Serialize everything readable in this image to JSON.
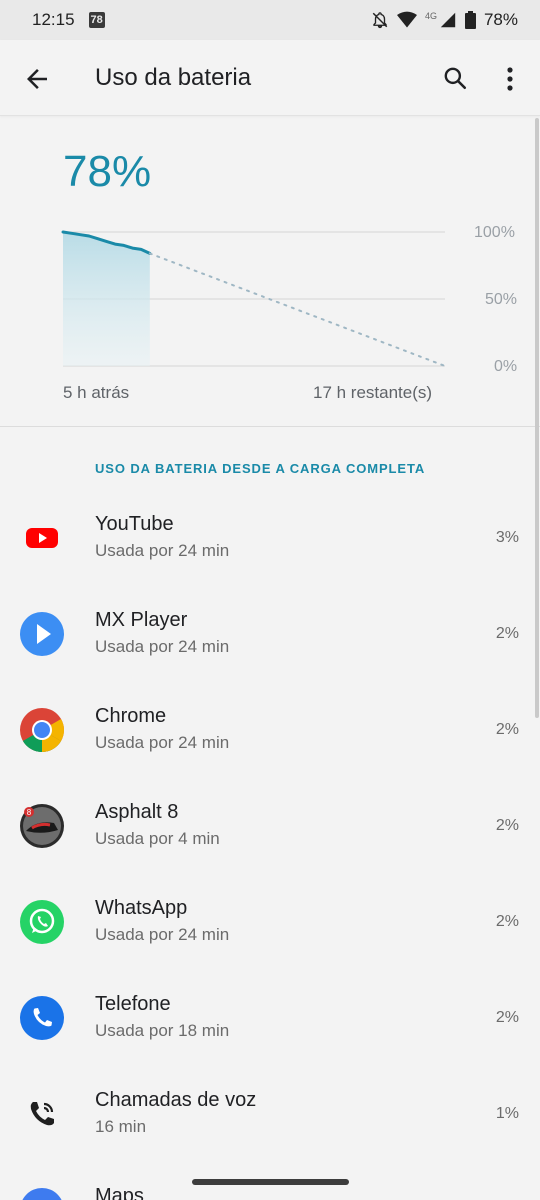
{
  "status_bar": {
    "time": "12:15",
    "notification_badge": "78",
    "network": "4G",
    "battery": "78%"
  },
  "app_bar": {
    "title": "Uso da bateria",
    "icons": [
      "back-arrow-icon",
      "search-icon",
      "more-vert-icon"
    ]
  },
  "summary": {
    "battery_percent": "78%",
    "y_ticks": [
      "100%",
      "50%",
      "0%"
    ],
    "x_start_label": "5 h atrás",
    "x_end_label": "17 h restante(s)"
  },
  "chart_data": {
    "type": "area",
    "y_ticks": [
      "100%",
      "50%",
      "0%"
    ],
    "ylim": [
      0,
      100
    ],
    "x_labels": [
      "5 h atrás",
      "17 h restante(s)"
    ],
    "series": [
      {
        "x": [
          0,
          0.5,
          1,
          1.5,
          2,
          2.5,
          3,
          3.5,
          4,
          4.5,
          5
        ],
        "values": [
          100,
          99,
          98,
          97,
          95,
          93,
          91,
          90,
          88,
          87,
          84
        ]
      }
    ],
    "projection": {
      "x": [
        5,
        22
      ],
      "values": [
        78,
        0
      ]
    },
    "grid": true,
    "accent_color": "#1a8aa8"
  },
  "section_header": "USO DA BATERIA DESDE A CARGA COMPLETA",
  "apps": [
    {
      "name": "YouTube",
      "usage": "Usada por 24 min",
      "percent": "3%",
      "icon": "youtube-icon"
    },
    {
      "name": "MX Player",
      "usage": "Usada por 24 min",
      "percent": "2%",
      "icon": "mx-player-icon"
    },
    {
      "name": "Chrome",
      "usage": "Usada por 24 min",
      "percent": "2%",
      "icon": "chrome-icon"
    },
    {
      "name": "Asphalt 8",
      "usage": "Usada por 4 min",
      "percent": "2%",
      "icon": "asphalt-8-icon"
    },
    {
      "name": "WhatsApp",
      "usage": "Usada por 24 min",
      "percent": "2%",
      "icon": "whatsapp-icon"
    },
    {
      "name": "Telefone",
      "usage": "Usada por 18 min",
      "percent": "2%",
      "icon": "phone-icon"
    },
    {
      "name": "Chamadas de voz",
      "usage": "16 min",
      "percent": "1%",
      "icon": "voice-call-icon"
    },
    {
      "name": "Maps",
      "usage": "",
      "percent": "",
      "icon": "maps-icon"
    }
  ]
}
